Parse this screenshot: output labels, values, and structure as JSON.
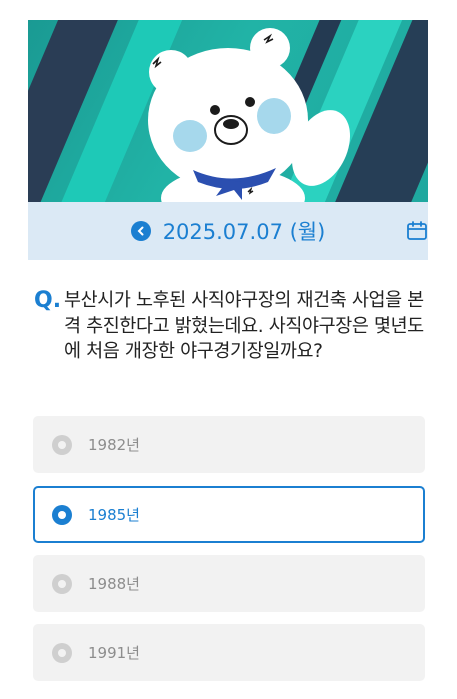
{
  "date_bar": {
    "date": "2025.07.07 (월)"
  },
  "question": {
    "marker": "Q.",
    "text": "부산시가 노후된 사직야구장의 재건축 사업을 본격 추진한다고 밝혔는데요. 사직야구장은 몇년도에 처음 개장한 야구경기장일까요?"
  },
  "options": [
    {
      "label": "1982년",
      "selected": false
    },
    {
      "label": "1985년",
      "selected": true
    },
    {
      "label": "1988년",
      "selected": false
    },
    {
      "label": "1991년",
      "selected": false
    }
  ],
  "icons": {
    "prev": "chevron-left-icon",
    "calendar": "calendar-icon"
  },
  "colors": {
    "accent": "#1b7fd1",
    "date_bar_bg": "#dbe9f5",
    "option_bg": "#f2f2f2",
    "banner_teal": "#21b3a6",
    "banner_navy": "#2a3d55"
  }
}
